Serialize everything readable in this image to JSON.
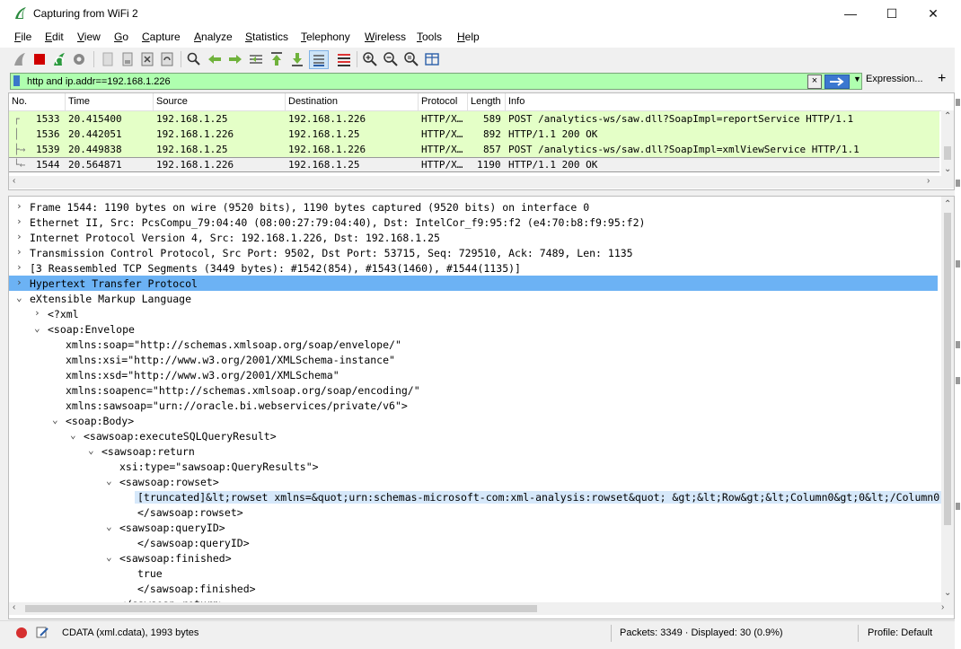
{
  "window": {
    "title": "Capturing from WiFi 2",
    "minimize": "—",
    "maximize": "☐",
    "close": "✕"
  },
  "menu": [
    "File",
    "Edit",
    "View",
    "Go",
    "Capture",
    "Analyze",
    "Statistics",
    "Telephony",
    "Wireless",
    "Tools",
    "Help"
  ],
  "filter": {
    "value": "http and ip.addr==192.168.1.226",
    "clear_icon": "×",
    "dropdown_icon": "▼",
    "expression_label": "Expression...",
    "add_label": "+"
  },
  "packet_list": {
    "columns": [
      "No.",
      "Time",
      "Source",
      "Destination",
      "Protocol",
      "Length",
      "Info"
    ],
    "rows": [
      {
        "no": "1533",
        "time": "20.415400",
        "src": "192.168.1.25",
        "dst": "192.168.1.226",
        "proto": "HTTP/X…",
        "len": "589",
        "info": "POST /analytics-ws/saw.dll?SoapImpl=reportService HTTP/1.1",
        "bg": "#e4ffc7",
        "rel": "┌"
      },
      {
        "no": "1536",
        "time": "20.442051",
        "src": "192.168.1.226",
        "dst": "192.168.1.25",
        "proto": "HTTP/X…",
        "len": "892",
        "info": "HTTP/1.1 200 OK",
        "bg": "#e4ffc7",
        "rel": "│"
      },
      {
        "no": "1539",
        "time": "20.449838",
        "src": "192.168.1.25",
        "dst": "192.168.1.226",
        "proto": "HTTP/X…",
        "len": "857",
        "info": "POST /analytics-ws/saw.dll?SoapImpl=xmlViewService HTTP/1.1",
        "bg": "#e4ffc7",
        "rel": "├→"
      },
      {
        "no": "1544",
        "time": "20.564871",
        "src": "192.168.1.226",
        "dst": "192.168.1.25",
        "proto": "HTTP/X…",
        "len": "1190",
        "info": "HTTP/1.1 200 OK",
        "bg": "#f0f0f0",
        "rel": "└←"
      }
    ]
  },
  "details": [
    {
      "indent": 0,
      "exp": "›",
      "text": "Frame 1544: 1190 bytes on wire (9520 bits), 1190 bytes captured (9520 bits) on interface 0"
    },
    {
      "indent": 0,
      "exp": "›",
      "text": "Ethernet II, Src: PcsCompu_79:04:40 (08:00:27:79:04:40), Dst: IntelCor_f9:95:f2 (e4:70:b8:f9:95:f2)"
    },
    {
      "indent": 0,
      "exp": "›",
      "text": "Internet Protocol Version 4, Src: 192.168.1.226, Dst: 192.168.1.25"
    },
    {
      "indent": 0,
      "exp": "›",
      "text": "Transmission Control Protocol, Src Port: 9502, Dst Port: 53715, Seq: 729510, Ack: 7489, Len: 1135"
    },
    {
      "indent": 0,
      "exp": "›",
      "text": "[3 Reassembled TCP Segments (3449 bytes): #1542(854), #1543(1460), #1544(1135)]"
    },
    {
      "indent": 0,
      "exp": "›",
      "text": "Hypertext Transfer Protocol",
      "sel": true
    },
    {
      "indent": 0,
      "exp": "⌄",
      "text": "eXtensible Markup Language"
    },
    {
      "indent": 1,
      "exp": "›",
      "text": "<?xml"
    },
    {
      "indent": 1,
      "exp": "⌄",
      "text": "<soap:Envelope"
    },
    {
      "indent": 2,
      "exp": "",
      "text": "xmlns:soap=\"http://schemas.xmlsoap.org/soap/envelope/\""
    },
    {
      "indent": 2,
      "exp": "",
      "text": "xmlns:xsi=\"http://www.w3.org/2001/XMLSchema-instance\""
    },
    {
      "indent": 2,
      "exp": "",
      "text": "xmlns:xsd=\"http://www.w3.org/2001/XMLSchema\""
    },
    {
      "indent": 2,
      "exp": "",
      "text": "xmlns:soapenc=\"http://schemas.xmlsoap.org/soap/encoding/\""
    },
    {
      "indent": 2,
      "exp": "",
      "text": "xmlns:sawsoap=\"urn://oracle.bi.webservices/private/v6\">"
    },
    {
      "indent": 2,
      "exp": "⌄",
      "text": "<soap:Body>"
    },
    {
      "indent": 3,
      "exp": "⌄",
      "text": "<sawsoap:executeSQLQueryResult>"
    },
    {
      "indent": 4,
      "exp": "⌄",
      "text": "<sawsoap:return"
    },
    {
      "indent": 5,
      "exp": "",
      "text": "xsi:type=\"sawsoap:QueryResults\">"
    },
    {
      "indent": 5,
      "exp": "⌄",
      "text": "<sawsoap:rowset>"
    },
    {
      "indent": 6,
      "exp": "",
      "text": "[truncated]&lt;rowset xmlns=&quot;urn:schemas-microsoft-com:xml-analysis:rowset&quot; &gt;&lt;Row&gt;&lt;Column0&gt;0&lt;/Column0",
      "hl": true
    },
    {
      "indent": 6,
      "exp": "",
      "text": "</sawsoap:rowset>"
    },
    {
      "indent": 5,
      "exp": "⌄",
      "text": "<sawsoap:queryID>"
    },
    {
      "indent": 6,
      "exp": "",
      "text": "</sawsoap:queryID>"
    },
    {
      "indent": 5,
      "exp": "⌄",
      "text": "<sawsoap:finished>"
    },
    {
      "indent": 6,
      "exp": "",
      "text": "true"
    },
    {
      "indent": 6,
      "exp": "",
      "text": "</sawsoap:finished>"
    },
    {
      "indent": 5,
      "exp": "",
      "text": "</sawsoap:return>"
    }
  ],
  "status": {
    "field_info": "CDATA (xml.cdata), 1993 bytes",
    "packets": "Packets: 3349 · Displayed: 30 (0.9%)",
    "profile": "Profile: Default"
  },
  "colors": {
    "http_row": "#e4ffc7",
    "selected": "#6cb2f4",
    "filter_ok": "#afffaf"
  }
}
